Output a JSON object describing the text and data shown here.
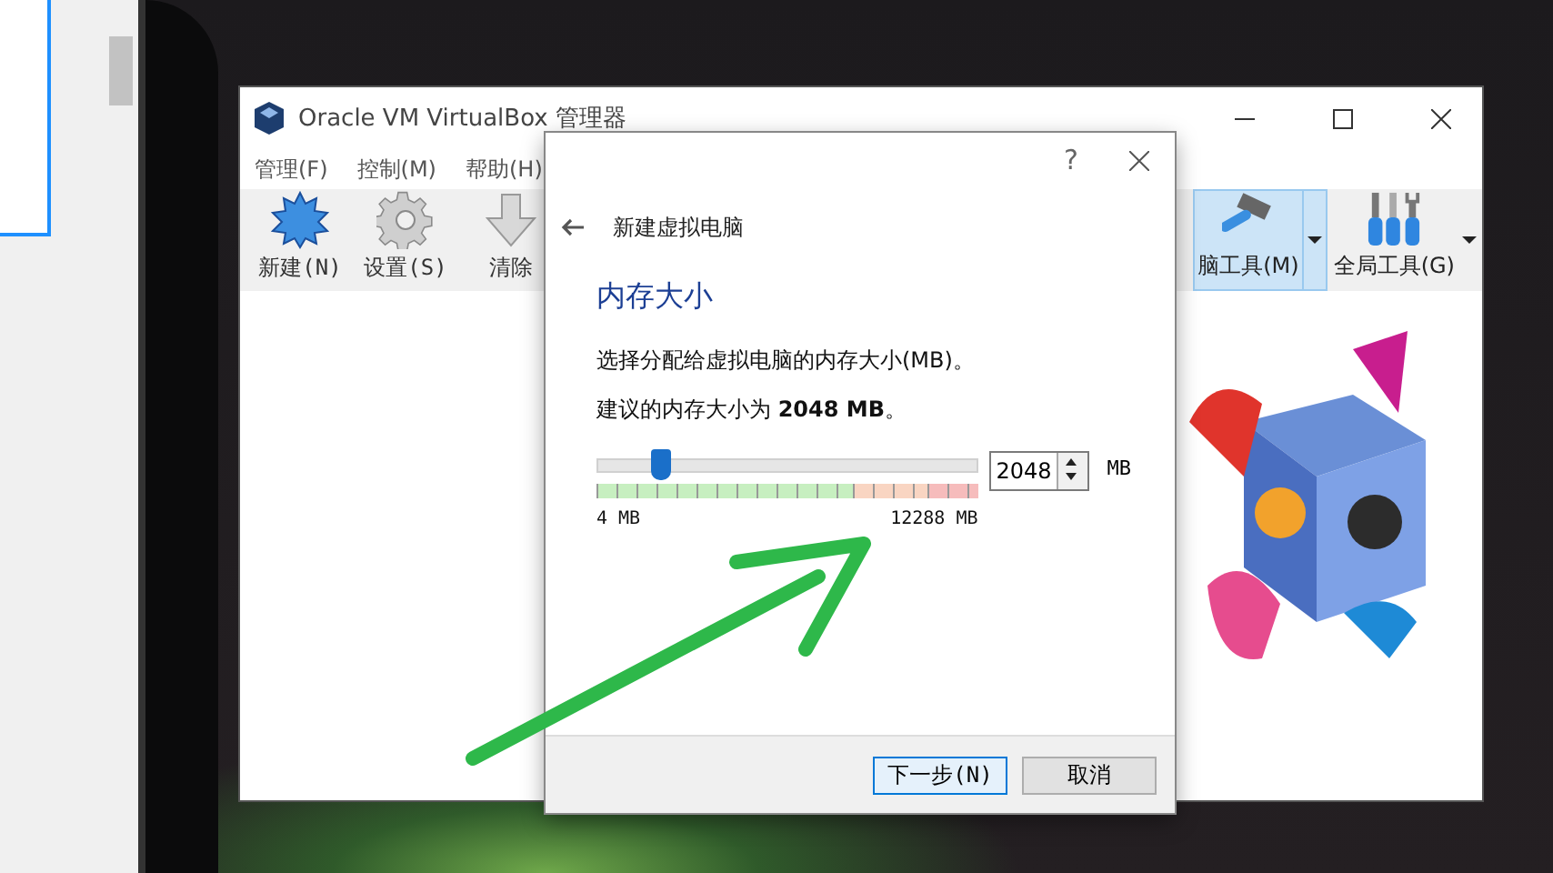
{
  "main_window": {
    "title": "Oracle VM VirtualBox 管理器",
    "menu": [
      "管理(F)",
      "控制(M)",
      "帮助(H)"
    ],
    "toolbar": [
      {
        "label": "新建(N)",
        "kind": "new"
      },
      {
        "label": "设置(S)",
        "kind": "settings"
      },
      {
        "label": "清除",
        "kind": "discard"
      }
    ],
    "tools": [
      {
        "label": "脑工具(M)",
        "kind": "machine",
        "selected": true
      },
      {
        "label": "全局工具(G)",
        "kind": "global",
        "selected": false
      }
    ]
  },
  "dialog": {
    "help": "?",
    "back_title": "新建虚拟电脑",
    "heading": "内存大小",
    "description": "选择分配给虚拟电脑的内存大小(MB)。",
    "recommendation": "建议的内存大小为 **2048 MB**。",
    "memory": {
      "level": 0.166,
      "value": "2048",
      "unit": "MB",
      "min_label": "4 MB",
      "max_label": "12288 MB"
    },
    "buttons": [
      {
        "label": "下一步(N)",
        "default": true
      },
      {
        "label": "取消",
        "default": false
      }
    ]
  }
}
